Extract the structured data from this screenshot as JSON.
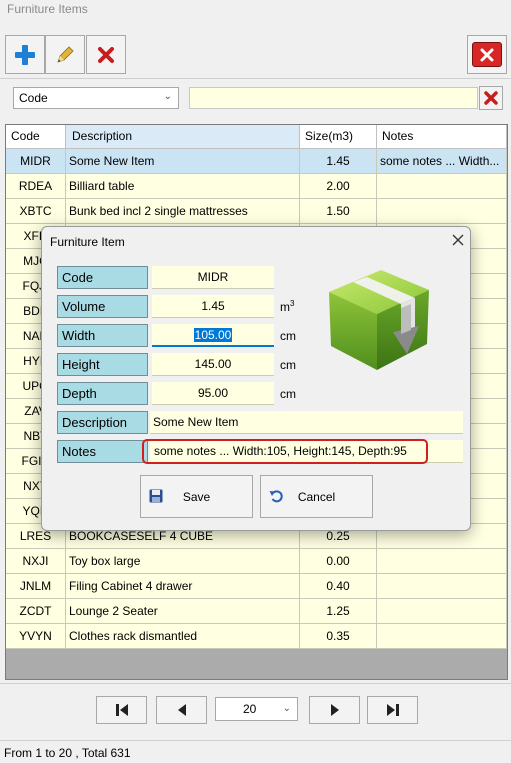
{
  "window": {
    "title": "Furniture Items"
  },
  "toolbar": {
    "add_icon": "plus-icon",
    "edit_icon": "pencil-icon",
    "delete_icon": "red-x-icon",
    "close_icon": "red-x-box-icon"
  },
  "filter": {
    "field": "Code",
    "value": ""
  },
  "grid": {
    "columns": [
      "Code",
      "Description",
      "Size(m3)",
      "Notes"
    ],
    "rows": [
      {
        "code": "MIDR",
        "desc": "Some New Item",
        "size": "1.45",
        "notes": "some notes ... Width:105, Height:145, Depth:95",
        "selected": true
      },
      {
        "code": "RDEA",
        "desc": "Billiard table",
        "size": "2.00",
        "notes": ""
      },
      {
        "code": "XBTC",
        "desc": "Bunk bed incl 2 single mattresses",
        "size": "1.50",
        "notes": ""
      },
      {
        "code": "XFH",
        "desc": "",
        "size": "",
        "notes": ""
      },
      {
        "code": "MJC",
        "desc": "",
        "size": "",
        "notes": ""
      },
      {
        "code": "FQJI",
        "desc": "",
        "size": "",
        "notes": ""
      },
      {
        "code": "BDE",
        "desc": "",
        "size": "",
        "notes": ""
      },
      {
        "code": "NAR",
        "desc": "",
        "size": "",
        "notes": ""
      },
      {
        "code": "HYK",
        "desc": "",
        "size": "",
        "notes": ""
      },
      {
        "code": "UPO",
        "desc": "",
        "size": "",
        "notes": ""
      },
      {
        "code": "ZAV",
        "desc": "",
        "size": "",
        "notes": ""
      },
      {
        "code": "NBT",
        "desc": "",
        "size": "",
        "notes": ""
      },
      {
        "code": "FGIV",
        "desc": "",
        "size": "",
        "notes": ""
      },
      {
        "code": "NXY",
        "desc": "",
        "size": "",
        "notes": ""
      },
      {
        "code": "YQD",
        "desc": "",
        "size": "",
        "notes": ""
      },
      {
        "code": "LRES",
        "desc": "BOOKCASESELF 4 CUBE",
        "size": "0.25",
        "notes": ""
      },
      {
        "code": "NXJI",
        "desc": "Toy box large",
        "size": "0.00",
        "notes": ""
      },
      {
        "code": "JNLM",
        "desc": "Filing Cabinet 4 drawer",
        "size": "0.40",
        "notes": ""
      },
      {
        "code": "ZCDT",
        "desc": "Lounge 2 Seater",
        "size": "1.25",
        "notes": ""
      },
      {
        "code": "YVYN",
        "desc": "Clothes rack dismantled",
        "size": "0.35",
        "notes": ""
      }
    ]
  },
  "navigation": {
    "first_icon": "first-page-icon",
    "prev_icon": "prev-page-icon",
    "next_icon": "next-page-icon",
    "last_icon": "last-page-icon",
    "page_size": "20"
  },
  "status": "From 1 to 20 , Total 631",
  "dialog": {
    "title": "Furniture Item",
    "code_label": "Code",
    "code_value": "MIDR",
    "volume_label": "Volume",
    "volume_value": "1.45",
    "volume_unit": "m",
    "volume_unit_sup": "3",
    "width_label": "Width",
    "width_value": "105.00",
    "width_unit": "cm",
    "height_label": "Height",
    "height_value": "145.00",
    "height_unit": "cm",
    "depth_label": "Depth",
    "depth_value": "95.00",
    "depth_unit": "cm",
    "description_label": "Description",
    "description_value": "Some New Item",
    "notes_label": "Notes",
    "notes_value": "some notes ... Width:105, Height:145, Depth:95",
    "save_label": "Save",
    "cancel_label": "Cancel",
    "box_icon": "green-package-icon"
  },
  "colors": {
    "field_bg": "#ffffe1",
    "label_bg": "#a9dbe4",
    "selected_row": "#cbe4f4",
    "highlight_outline": "#d11f1f",
    "selection_blue": "#0078d7"
  }
}
